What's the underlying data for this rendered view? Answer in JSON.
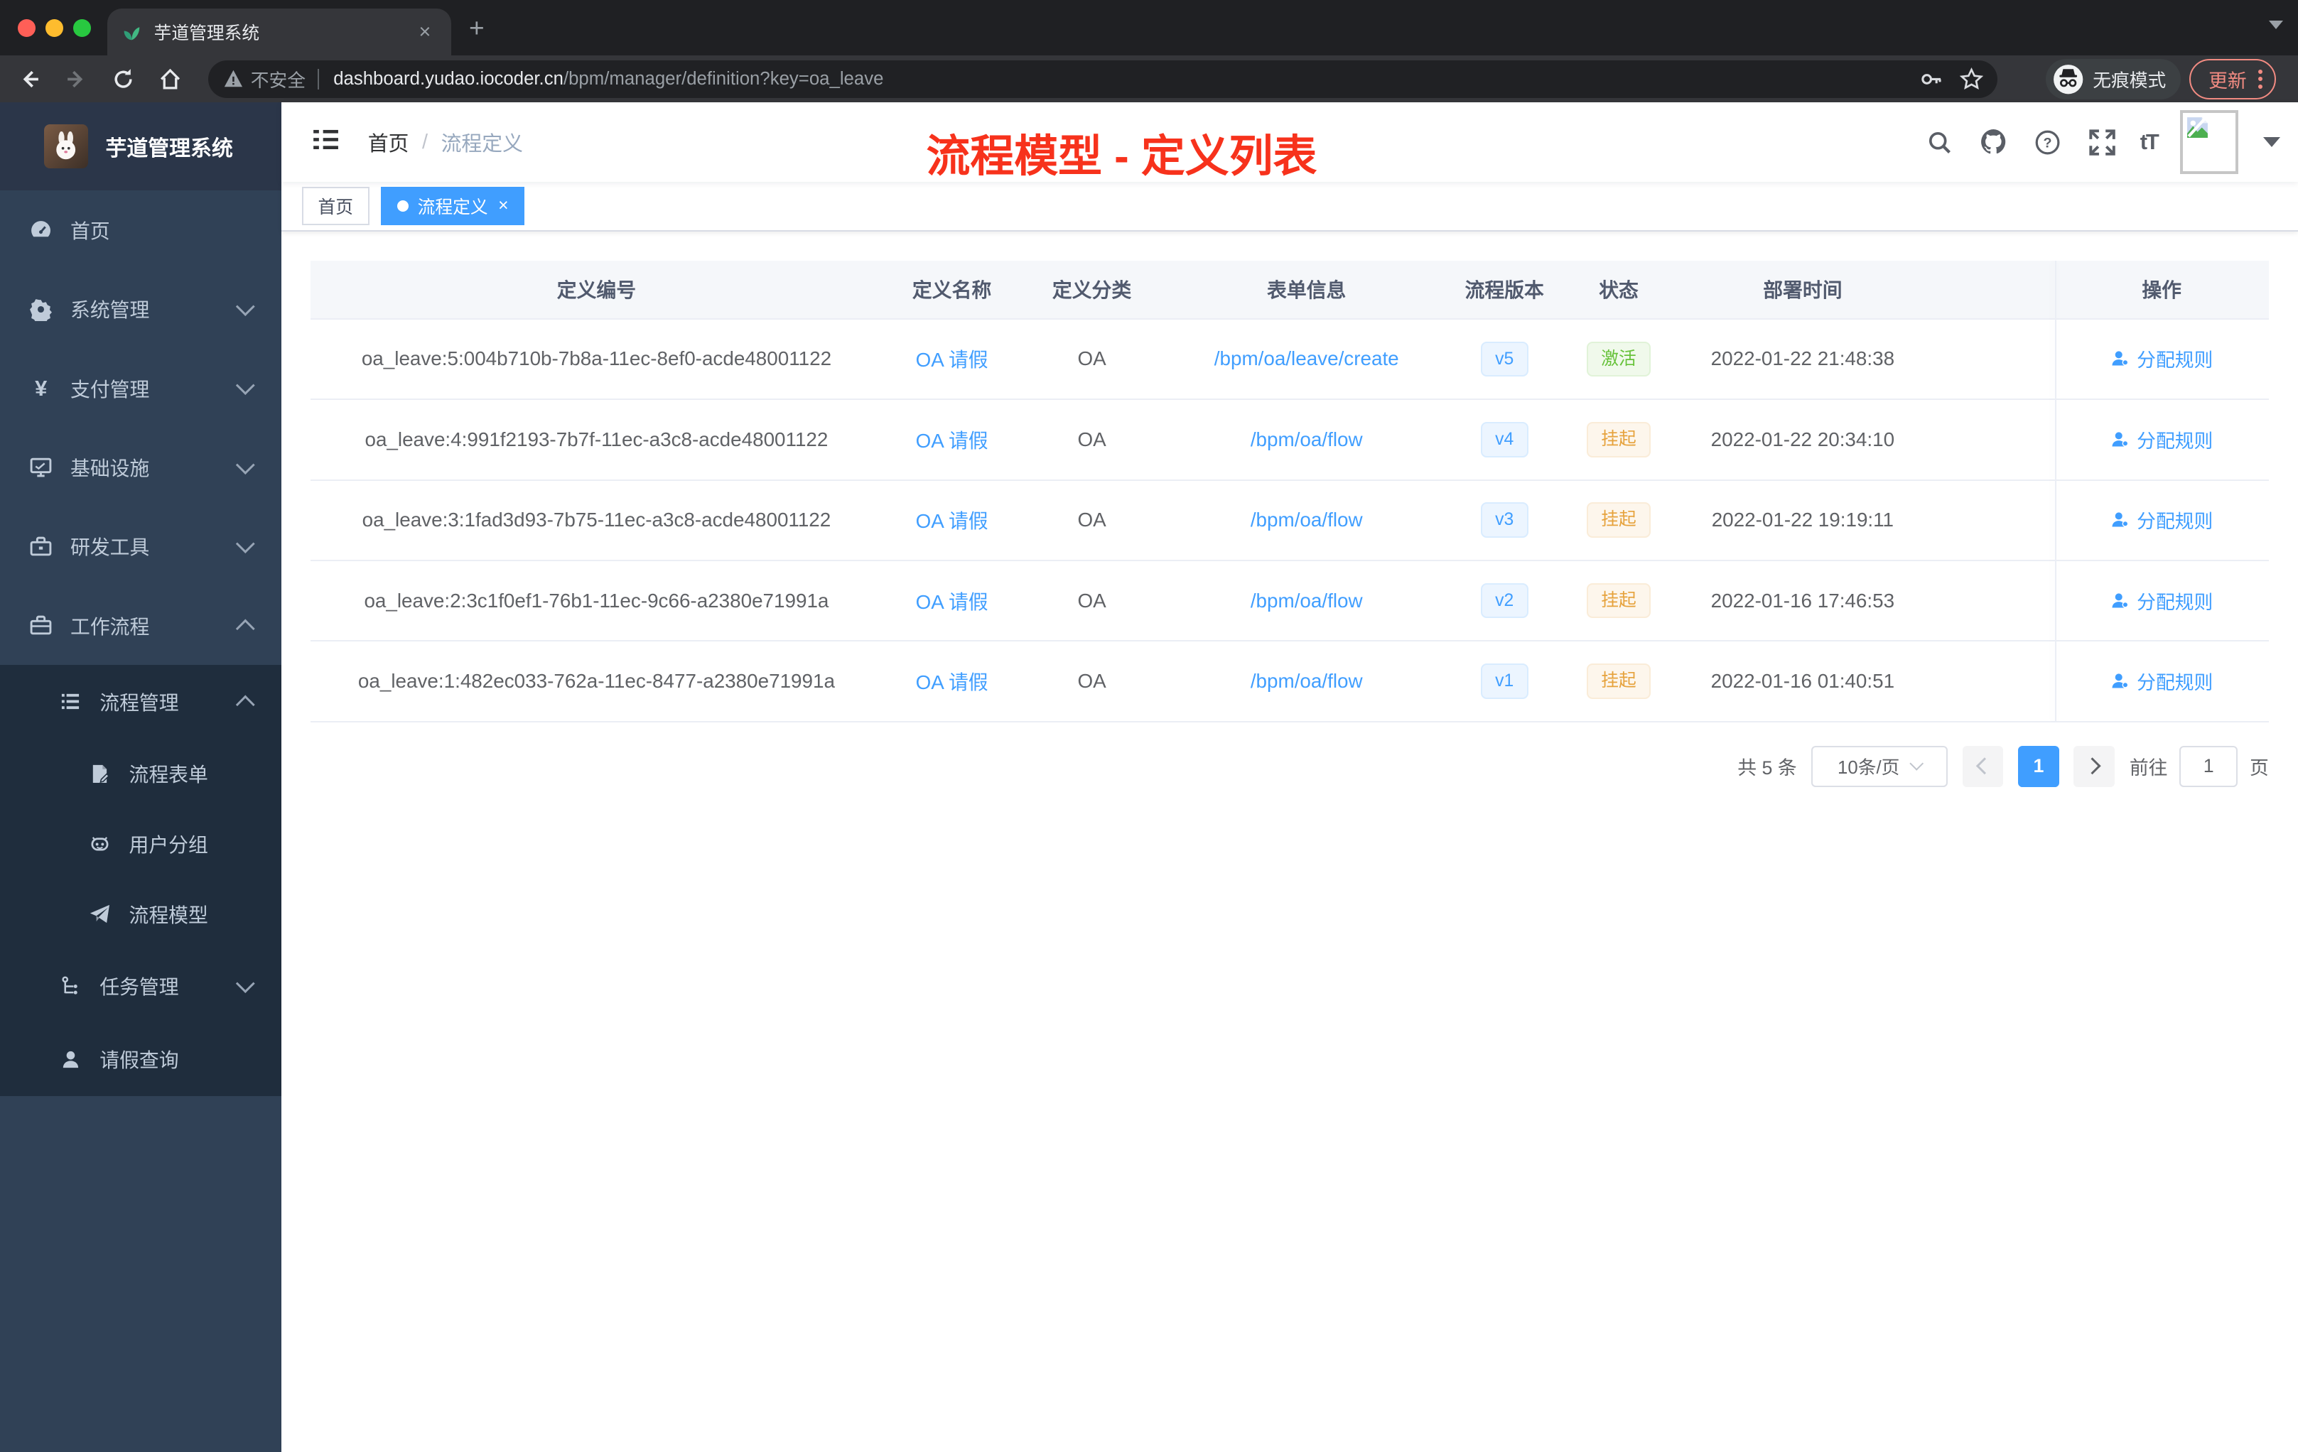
{
  "browser": {
    "tab_title": "芋道管理系统",
    "tab_close": "×",
    "new_tab": "+",
    "address": {
      "security_label": "不安全",
      "host": "dashboard.yudao.iocoder.cn",
      "path": "/bpm/manager/definition?key=oa_leave"
    },
    "incognito_label": "无痕模式",
    "update_label": "更新"
  },
  "sidebar": {
    "logo_title": "芋道管理系统",
    "menu": [
      {
        "label": "首页",
        "icon": "dashboard-icon"
      },
      {
        "label": "系统管理",
        "icon": "gear-icon",
        "chevron": "down"
      },
      {
        "label": "支付管理",
        "icon": "yen-icon",
        "chevron": "down",
        "icon_glyph": "¥"
      },
      {
        "label": "基础设施",
        "icon": "monitor-icon",
        "chevron": "down"
      },
      {
        "label": "研发工具",
        "icon": "toolbox-icon",
        "chevron": "down"
      },
      {
        "label": "工作流程",
        "icon": "briefcase-icon",
        "chevron": "up"
      },
      {
        "label": "流程管理",
        "icon": "list-icon",
        "chevron": "up"
      },
      {
        "label": "流程表单",
        "icon": "form-icon"
      },
      {
        "label": "用户分组",
        "icon": "robot-icon"
      },
      {
        "label": "流程模型",
        "icon": "send-icon"
      },
      {
        "label": "任务管理",
        "icon": "tree-icon",
        "chevron": "down"
      },
      {
        "label": "请假查询",
        "icon": "user-icon"
      }
    ]
  },
  "navbar": {
    "breadcrumb_home": "首页",
    "breadcrumb_sep": "/",
    "breadcrumb_current": "流程定义",
    "font_size_icon": "tT",
    "annotation": "流程模型 - 定义列表"
  },
  "tags": {
    "home": "首页",
    "active": "流程定义",
    "close": "×"
  },
  "table": {
    "headers": [
      "定义编号",
      "定义名称",
      "定义分类",
      "表单信息",
      "流程版本",
      "状态",
      "部署时间",
      "操作"
    ],
    "rows": [
      {
        "id": "oa_leave:5:004b710b-7b8a-11ec-8ef0-acde48001122",
        "name": "OA 请假",
        "category": "OA",
        "form": "/bpm/oa/leave/create",
        "version": "v5",
        "status": "激活",
        "status_type": "success",
        "deploy_time": "2022-01-22 21:48:38",
        "action": "分配规则"
      },
      {
        "id": "oa_leave:4:991f2193-7b7f-11ec-a3c8-acde48001122",
        "name": "OA 请假",
        "category": "OA",
        "form": "/bpm/oa/flow",
        "version": "v4",
        "status": "挂起",
        "status_type": "warning",
        "deploy_time": "2022-01-22 20:34:10",
        "action": "分配规则"
      },
      {
        "id": "oa_leave:3:1fad3d93-7b75-11ec-a3c8-acde48001122",
        "name": "OA 请假",
        "category": "OA",
        "form": "/bpm/oa/flow",
        "version": "v3",
        "status": "挂起",
        "status_type": "warning",
        "deploy_time": "2022-01-22 19:19:11",
        "action": "分配规则"
      },
      {
        "id": "oa_leave:2:3c1f0ef1-76b1-11ec-9c66-a2380e71991a",
        "name": "OA 请假",
        "category": "OA",
        "form": "/bpm/oa/flow",
        "version": "v2",
        "status": "挂起",
        "status_type": "warning",
        "deploy_time": "2022-01-16 17:46:53",
        "action": "分配规则"
      },
      {
        "id": "oa_leave:1:482ec033-762a-11ec-8477-a2380e71991a",
        "name": "OA 请假",
        "category": "OA",
        "form": "/bpm/oa/flow",
        "version": "v1",
        "status": "挂起",
        "status_type": "warning",
        "deploy_time": "2022-01-16 01:40:51",
        "action": "分配规则"
      }
    ]
  },
  "pagination": {
    "total_label": "共 5 条",
    "page_size_label": "10条/页",
    "current_page": "1",
    "goto_label": "前往",
    "goto_value": "1",
    "page_unit": "页"
  },
  "colors": {
    "accent_blue": "#409eff",
    "success_green": "#67c23a",
    "warning_orange": "#e6a23c",
    "annotation_red": "#f7321c",
    "sidebar_bg": "#304156",
    "sidebar_submenu_bg": "#1f2d3d",
    "table_header_bg": "#f5f7fa"
  }
}
